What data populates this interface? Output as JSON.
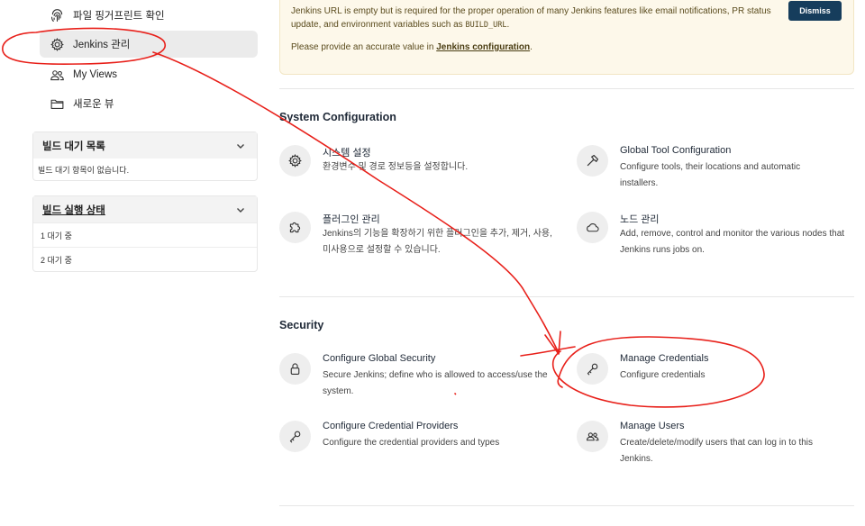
{
  "sidebar": {
    "items": [
      {
        "label": "파일 핑거프린트 확인",
        "icon": "fingerprint-icon"
      },
      {
        "label": "Jenkins 관리",
        "icon": "gear-icon"
      },
      {
        "label": "My Views",
        "icon": "people-icon"
      },
      {
        "label": "새로운 뷰",
        "icon": "folder-icon"
      }
    ],
    "build_queue": {
      "title": "빌드 대기 목록",
      "empty": "빌드 대기 항목이 없습니다."
    },
    "executors": {
      "title": "빌드 실행 상태",
      "rows": [
        "1  대기 중",
        "2  대기 중"
      ]
    }
  },
  "notice": {
    "line1_pre": "Jenkins URL is empty but is required for the proper operation of many Jenkins features like email notifications, PR status update, and environment variables such as ",
    "code": "BUILD_URL",
    "line1_post": ".",
    "line2_pre": "Please provide an accurate value in ",
    "link": "Jenkins configuration",
    "line2_post": ".",
    "dismiss": "Dismiss"
  },
  "sections": {
    "system": {
      "title": "System Configuration",
      "cards": [
        {
          "title": "시스템 설정",
          "desc": "환경변수 및 경로 정보등을 설정합니다.",
          "icon": "gear-icon"
        },
        {
          "title": "Global Tool Configuration",
          "desc": "Configure tools, their locations and automatic installers.",
          "icon": "hammer-icon"
        },
        {
          "title": "플러그인 관리",
          "desc": "Jenkins의 기능을 확장하기 위한 플러그인을 추가, 제거, 사용, 미사용으로 설정할 수 있습니다.",
          "icon": "puzzle-icon"
        },
        {
          "title": "노드 관리",
          "desc": "Add, remove, control and monitor the various nodes that Jenkins runs jobs on.",
          "icon": "cloud-icon"
        }
      ]
    },
    "security": {
      "title": "Security",
      "cards": [
        {
          "title": "Configure Global Security",
          "desc": "Secure Jenkins; define who is allowed to access/use the system.",
          "icon": "lock-icon"
        },
        {
          "title": "Manage Credentials",
          "desc": "Configure credentials",
          "icon": "key-icon"
        },
        {
          "title": "Configure Credential Providers",
          "desc": "Configure the credential providers and types",
          "icon": "key-icon"
        },
        {
          "title": "Manage Users",
          "desc": "Create/delete/modify users that can log in to this Jenkins.",
          "icon": "users-icon"
        }
      ]
    }
  },
  "colors": {
    "annotation": "#e8201a",
    "dismiss_bg": "#163d5c",
    "notice_bg": "#fdf8ea"
  }
}
